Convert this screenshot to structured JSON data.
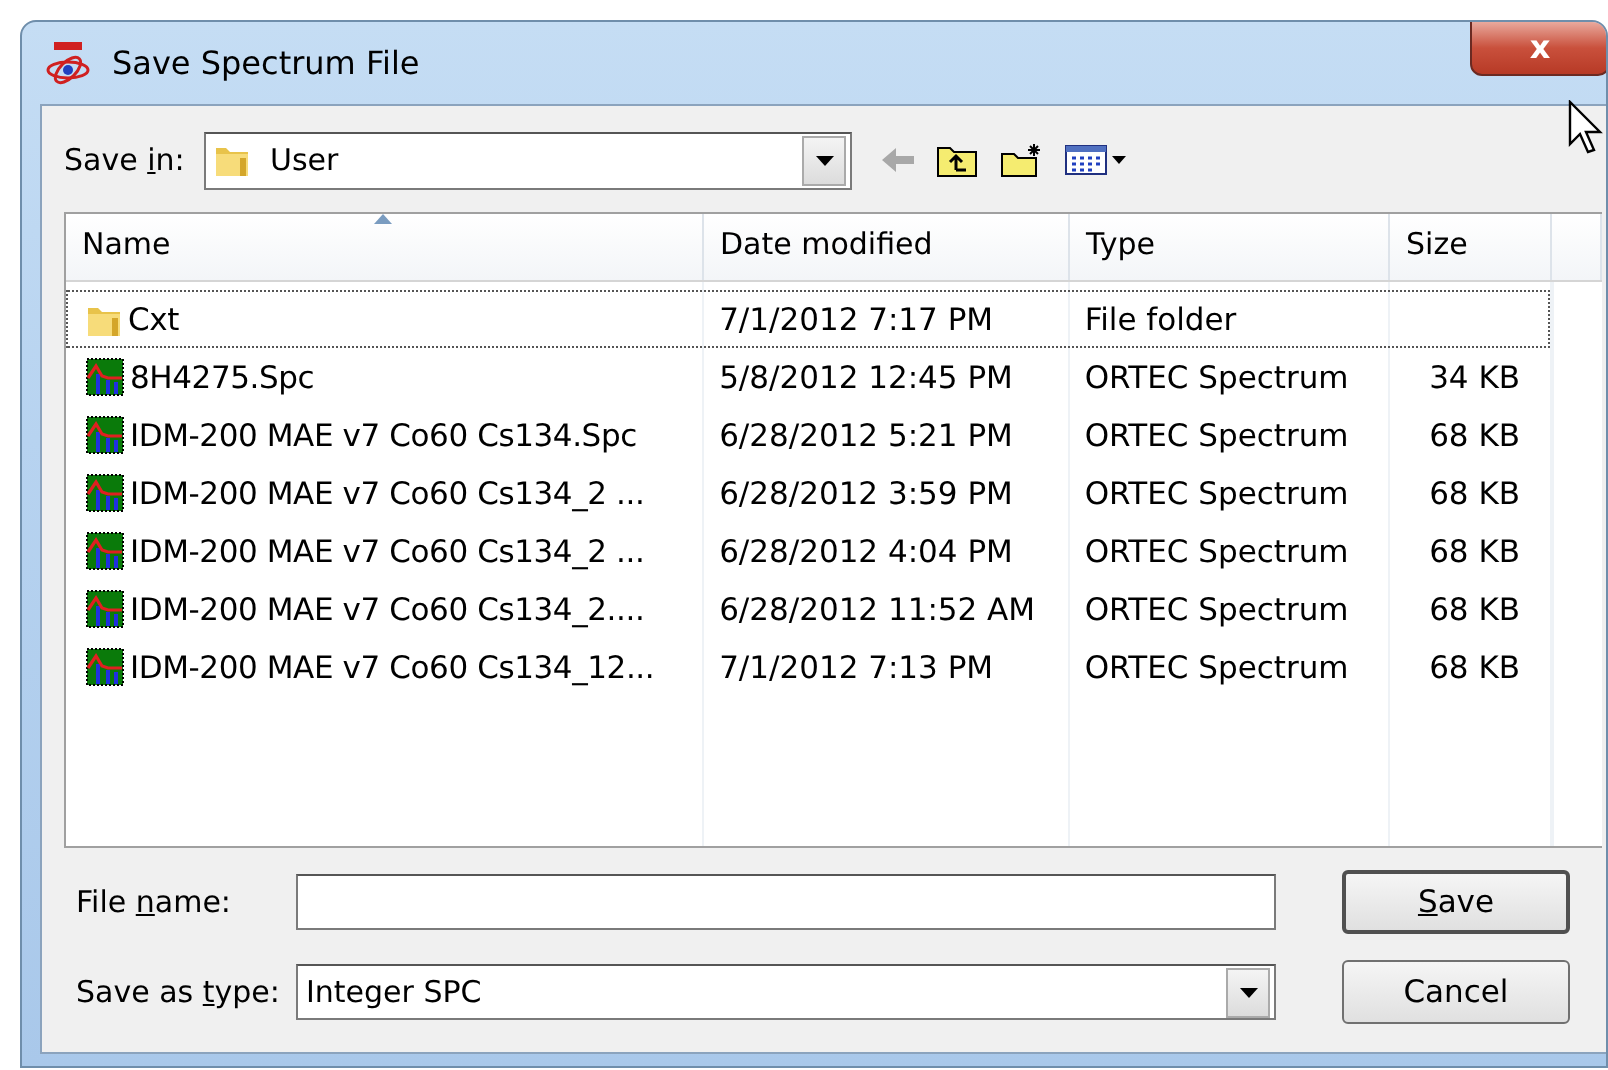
{
  "window": {
    "title": "Save Spectrum File",
    "close": "x"
  },
  "save_in": {
    "label_before": "Save ",
    "access_key": "i",
    "label_after": "n:",
    "value": "User"
  },
  "toolbar": [
    {
      "kind": "back",
      "disabled": true
    },
    {
      "kind": "up",
      "disabled": false
    },
    {
      "kind": "new_folder",
      "disabled": false
    },
    {
      "kind": "view_menu",
      "disabled": false
    }
  ],
  "table": {
    "columns": [
      {
        "label": "Name",
        "sorted": true
      },
      {
        "label": "Date modified",
        "sorted": false
      },
      {
        "label": "Type",
        "sorted": false
      },
      {
        "label": "Size",
        "sorted": false
      }
    ],
    "rows": [
      {
        "kind": "folder",
        "focused": true,
        "cells": [
          "Cxt",
          "7/1/2012 7:17 PM",
          "File folder",
          null
        ]
      },
      {
        "kind": "spectrum",
        "focused": false,
        "cells": [
          "8H4275.Spc",
          "5/8/2012 12:45 PM",
          "ORTEC Spectrum",
          "34 KB"
        ]
      },
      {
        "kind": "spectrum",
        "focused": false,
        "cells": [
          "IDM-200 MAE v7 Co60 Cs134.Spc",
          "6/28/2012 5:21 PM",
          "ORTEC Spectrum",
          "68 KB"
        ]
      },
      {
        "kind": "spectrum",
        "focused": false,
        "cells": [
          "IDM-200 MAE v7 Co60 Cs134_2 ...",
          "6/28/2012 3:59 PM",
          "ORTEC Spectrum",
          "68 KB"
        ]
      },
      {
        "kind": "spectrum",
        "focused": false,
        "cells": [
          "IDM-200 MAE v7 Co60 Cs134_2 ...",
          "6/28/2012 4:04 PM",
          "ORTEC Spectrum",
          "68 KB"
        ]
      },
      {
        "kind": "spectrum",
        "focused": false,
        "cells": [
          "IDM-200 MAE v7 Co60 Cs134_2....",
          "6/28/2012 11:52 AM",
          "ORTEC Spectrum",
          "68 KB"
        ]
      },
      {
        "kind": "spectrum",
        "focused": false,
        "cells": [
          "IDM-200 MAE v7 Co60 Cs134_12...",
          "7/1/2012 7:13 PM",
          "ORTEC Spectrum",
          "68 KB"
        ]
      }
    ]
  },
  "file_name": {
    "label_before": "File ",
    "access_key": "n",
    "label_after": "ame:"
  },
  "save_as_type": {
    "label_before": "Save as ",
    "access_key": "t",
    "label_after": "ype:",
    "value": "Integer SPC"
  },
  "buttons": [
    {
      "access_key": "S",
      "label_after": "ave",
      "default": true
    },
    {
      "label": "Cancel",
      "default": false
    }
  ]
}
